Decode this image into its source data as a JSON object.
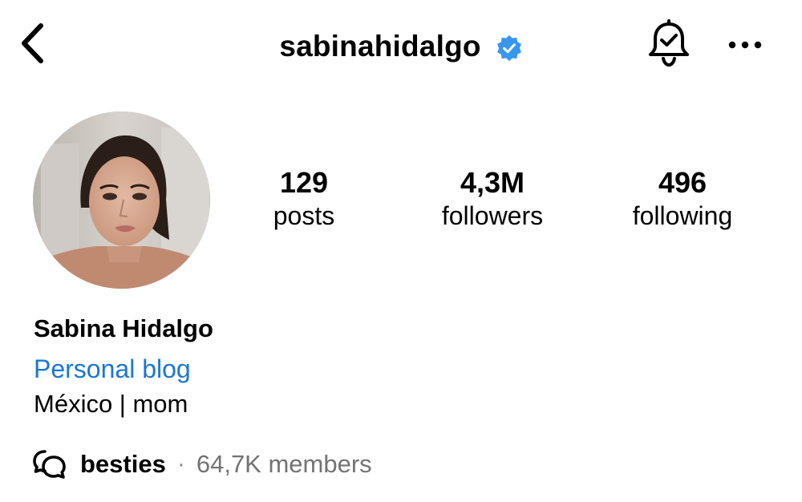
{
  "header": {
    "back_icon": "chevron-left-icon",
    "username": "sabinahidalgo",
    "verified_icon": "verified-badge-icon",
    "verified_color": "#3797f0",
    "notifications_icon": "bell-check-icon",
    "more_icon": "more-horizontal-icon"
  },
  "profile": {
    "avatar": "profile-photo",
    "stats": {
      "posts": {
        "value": "129",
        "label": "posts"
      },
      "followers": {
        "value": "4,3M",
        "label": "followers"
      },
      "following": {
        "value": "496",
        "label": "following"
      }
    },
    "display_name": "Sabina Hidalgo",
    "category": "Personal blog",
    "category_color": "#1a77d2",
    "bio": "México | mom"
  },
  "channel": {
    "icon": "broadcast-chat-icon",
    "name": "besties",
    "separator": "·",
    "members": "64,7K members"
  }
}
